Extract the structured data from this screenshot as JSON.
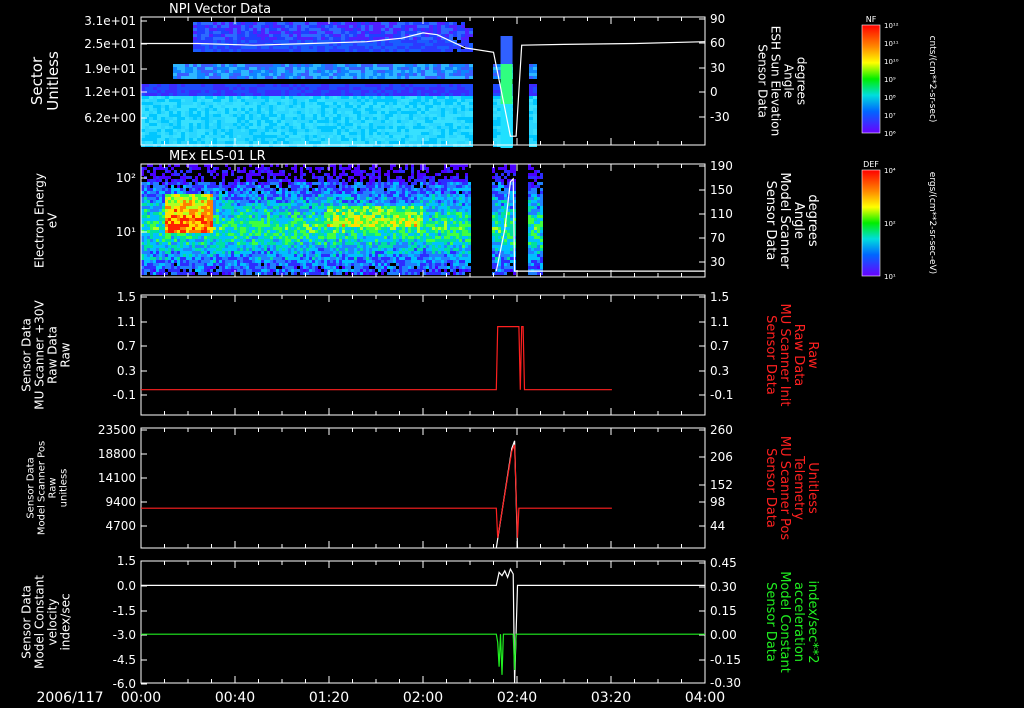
{
  "date_label": "2006/117",
  "x_ticks": [
    "00:00",
    "00:40",
    "01:20",
    "02:00",
    "02:40",
    "03:20",
    "04:00"
  ],
  "colorbars": [
    {
      "title": "NF",
      "unit": "cm^-3/(cm**2-sr-sec)",
      "unit_display": "cnts/(cm**2-sr-sec)",
      "ticks": [
        "10^12",
        "10^11",
        "10^10",
        "10^9",
        "10^8",
        "10^7",
        "10^6"
      ]
    },
    {
      "title": "DEF",
      "unit_display": "ergs/(cm**2-sr-sec-eV)",
      "ticks": [
        "10^4",
        "10^2",
        "10^1"
      ]
    }
  ],
  "colors": {
    "red": "#ff2020",
    "green": "#20ee20",
    "white": "#ffffff"
  },
  "chart_data": [
    {
      "type": "heatmap",
      "title": "NPI Vector Data",
      "ylabel": "Sector\nUnitless",
      "yticks": [
        "3.1e+01",
        "2.5e+01",
        "1.9e+01",
        "1.2e+01",
        "6.2e+00"
      ],
      "y2label": "Sensor Data\nESH Sun Elevation\nAngle\ndegrees",
      "y2ticks": [
        "90",
        "60",
        "30",
        "0",
        "-30"
      ],
      "data_gap_hours": [
        [
          2.33,
          2.48
        ],
        [
          2.62,
          2.73
        ]
      ],
      "overlay_line": {
        "name": "Sensor Data ESH Sun Elevation Angle",
        "color": "#ffffff",
        "x_hours": [
          0,
          0.4,
          0.8,
          1.2,
          1.6,
          1.85,
          2.0,
          2.1,
          2.3,
          2.5,
          2.62,
          2.66,
          2.7,
          3.0,
          3.5,
          4.0
        ],
        "y": [
          60,
          60,
          58,
          60,
          62,
          66,
          72,
          70,
          55,
          50,
          -45,
          -45,
          58,
          59,
          60,
          62
        ]
      }
    },
    {
      "type": "heatmap",
      "title": "MEx ELS-01 LR",
      "ylabel": "Electron Energy\neV",
      "yticks": [
        "10^2",
        "10^1"
      ],
      "y2label": "Sensor Data\nModel Scanner\nAngle\ndegrees",
      "y2ticks": [
        "190",
        "150",
        "110",
        "70",
        "30"
      ],
      "overlay_line": {
        "name": "Sensor Data Model Scanner Angle",
        "color": "#ffffff",
        "x_hours": [
          2.52,
          2.58,
          2.62,
          2.64,
          2.65,
          2.66,
          4.0
        ],
        "y": [
          10,
          80,
          160,
          165,
          10,
          10,
          10
        ]
      }
    },
    {
      "type": "line",
      "ylabel": "Sensor Data\nMU Scanner +30V\nRaw Data\nRaw",
      "yticks": [
        "1.5",
        "1.1",
        "0.7",
        "0.3",
        "-0.1"
      ],
      "ylim": [
        -0.4,
        1.5
      ],
      "y2label": "Sensor Data\nMU Scanner Init\nRaw Data\nRaw",
      "y2ticks": [
        "1.5",
        "1.1",
        "0.7",
        "0.3",
        "-0.1"
      ],
      "series": [
        {
          "name": "Sensor Data MU Scanner Init Raw Data",
          "color": "#ff2020",
          "x_hours": [
            0,
            2.52,
            2.53,
            2.68,
            2.69,
            2.7,
            2.71,
            2.72,
            3.34
          ],
          "y": [
            0.0,
            0.0,
            1.0,
            1.0,
            0.0,
            1.0,
            1.0,
            0.0,
            0.0
          ]
        }
      ]
    },
    {
      "type": "line",
      "ylabel": "Sensor Data\nModel Scanner Pos\nRaw\nunitless",
      "yticks": [
        "23500",
        "18800",
        "14100",
        "9400",
        "4700"
      ],
      "ylim": [
        0,
        23500
      ],
      "y2label": "Sensor Data\nMU Scanner Pos\nTelemetry\nUnitless",
      "y2ticks": [
        "260",
        "206",
        "152",
        "98",
        "44"
      ],
      "series": [
        {
          "name": "Sensor Data Model Scanner Pos",
          "color": "#ffffff",
          "x_hours": [
            2.52,
            2.63,
            2.65,
            2.67
          ],
          "y": [
            0,
            19500,
            21000,
            0
          ]
        },
        {
          "name": "Sensor Data MU Scanner Pos Telemetry",
          "color": "#ff2020",
          "x_hours": [
            0,
            2.52,
            2.53,
            2.63,
            2.65,
            2.67,
            2.68,
            3.34
          ],
          "y": [
            7800,
            7800,
            2000,
            19000,
            20200,
            2000,
            7800,
            7800
          ]
        }
      ]
    },
    {
      "type": "line",
      "ylabel": "Sensor Data\nModel Constant\nvelocity\nindex/sec",
      "yticks": [
        "1.5",
        "0.0",
        "-1.5",
        "-3.0",
        "-4.5",
        "-6.0"
      ],
      "ylim": [
        -6.0,
        1.5
      ],
      "y2label": "Sensor Data\nModel Constant\nacceleration\nindex/sec**2",
      "y2ticks": [
        "0.45",
        "0.30",
        "0.15",
        "0.00",
        "-0.15",
        "-0.30"
      ],
      "series": [
        {
          "name": "Sensor Data Model Constant velocity",
          "color": "#ffffff",
          "x_hours": [
            0,
            2.52,
            2.54,
            2.56,
            2.58,
            2.6,
            2.62,
            2.64,
            2.65,
            2.67,
            4.0
          ],
          "y": [
            0.0,
            0.0,
            0.8,
            0.6,
            0.9,
            0.5,
            1.0,
            0.7,
            -6.0,
            0.0,
            0.0
          ]
        },
        {
          "name": "Sensor Data Model Constant acceleration",
          "color": "#20ee20",
          "x_hours": [
            0,
            2.52,
            2.53,
            2.54,
            2.55,
            2.56,
            2.57,
            2.64,
            2.65,
            2.66,
            4.0
          ],
          "y": [
            0.0,
            0.0,
            -0.05,
            -0.2,
            0.0,
            -0.25,
            0.0,
            0.0,
            -0.22,
            0.0,
            0.0
          ]
        }
      ]
    }
  ]
}
